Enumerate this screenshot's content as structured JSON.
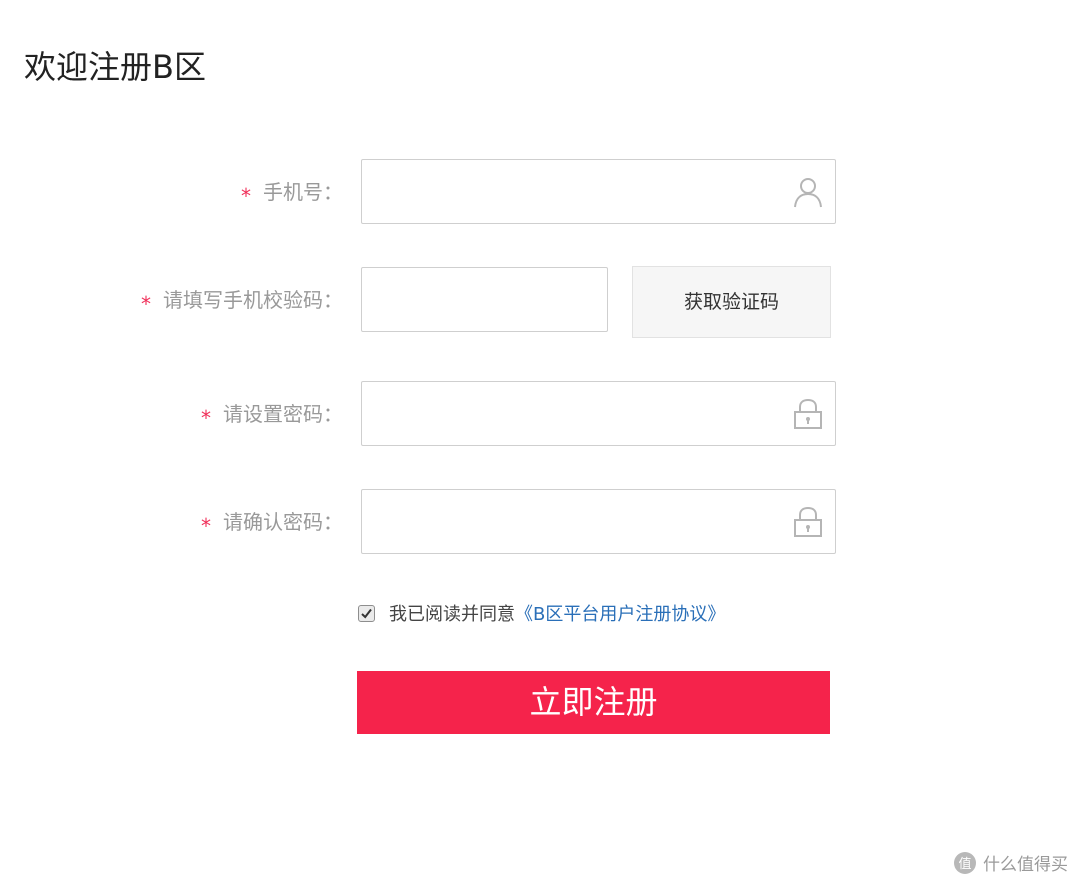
{
  "page": {
    "title": "欢迎注册B区"
  },
  "form": {
    "required_mark": "*",
    "phone": {
      "label": "手机号：",
      "value": "",
      "placeholder": "",
      "icon": "user-icon"
    },
    "verify_code": {
      "label": "请填写手机校验码：",
      "value": "",
      "placeholder": "",
      "button_label": "获取验证码"
    },
    "password": {
      "label": "请设置密码：",
      "value": "",
      "placeholder": "",
      "icon": "lock-icon"
    },
    "confirm_password": {
      "label": "请确认密码：",
      "value": "",
      "placeholder": "",
      "icon": "lock-icon"
    },
    "agreement": {
      "checked": true,
      "text": "我已阅读并同意",
      "link_text": "《B区平台用户注册协议》"
    },
    "submit_label": "立即注册"
  },
  "watermark": {
    "text": "什么值得买",
    "icon": "zhi-logo-icon"
  },
  "colors": {
    "accent": "#f5234b",
    "required": "#f0305a",
    "link": "#2a6fb8",
    "label": "#999999",
    "border": "#cfcfcf"
  }
}
